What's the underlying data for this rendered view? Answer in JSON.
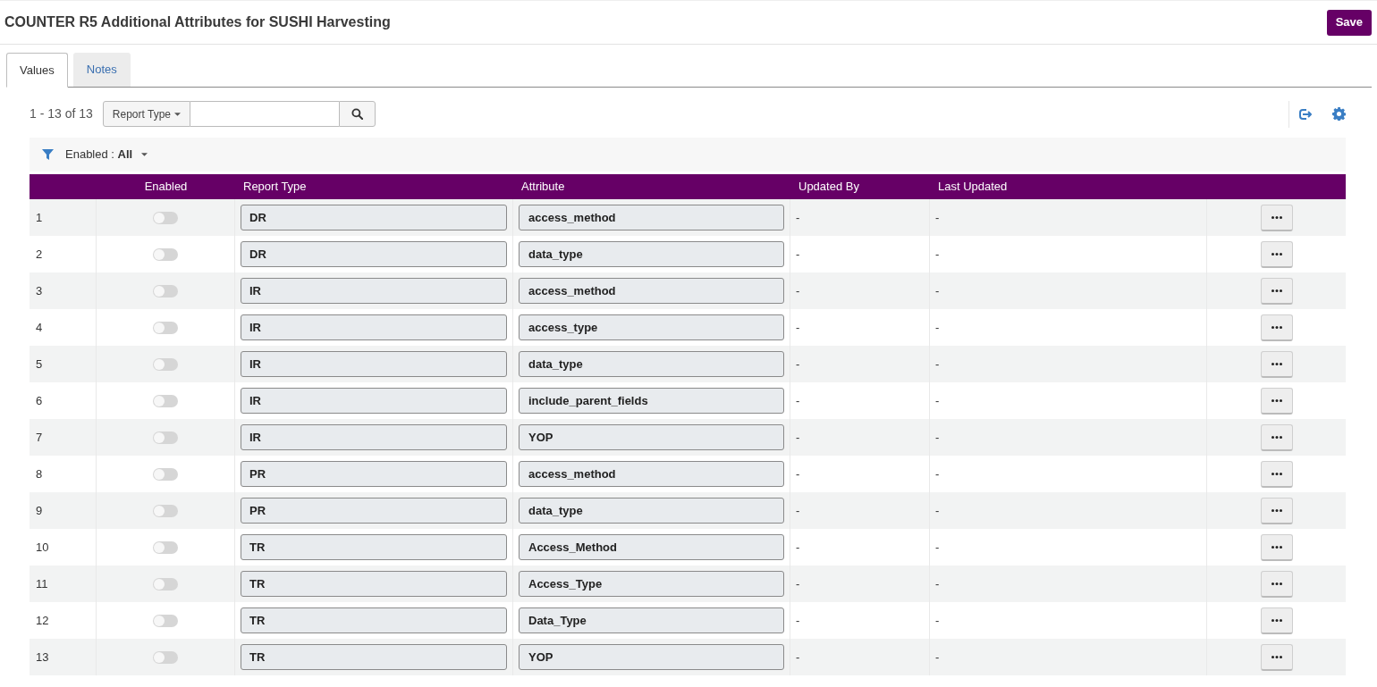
{
  "header": {
    "title": "COUNTER R5 Additional Attributes for SUSHI Harvesting",
    "save_button": "Save"
  },
  "tabs": [
    {
      "label": "Values",
      "selected": true
    },
    {
      "label": "Notes",
      "selected": false
    }
  ],
  "toolbar": {
    "count": "1 - 13 of 13",
    "search_scope": "Report Type"
  },
  "filter": {
    "label": "Enabled :",
    "value": "All"
  },
  "table": {
    "columns": [
      "Enabled",
      "Report Type",
      "Attribute",
      "Updated By",
      "Last Updated"
    ],
    "rows": [
      {
        "index": "1",
        "enabled": false,
        "report_type": "DR",
        "attribute": "access_method",
        "updated_by": "-",
        "last_updated": "-"
      },
      {
        "index": "2",
        "enabled": false,
        "report_type": "DR",
        "attribute": "data_type",
        "updated_by": "-",
        "last_updated": "-"
      },
      {
        "index": "3",
        "enabled": false,
        "report_type": "IR",
        "attribute": "access_method",
        "updated_by": "-",
        "last_updated": "-"
      },
      {
        "index": "4",
        "enabled": false,
        "report_type": "IR",
        "attribute": "access_type",
        "updated_by": "-",
        "last_updated": "-"
      },
      {
        "index": "5",
        "enabled": false,
        "report_type": "IR",
        "attribute": "data_type",
        "updated_by": "-",
        "last_updated": "-"
      },
      {
        "index": "6",
        "enabled": false,
        "report_type": "IR",
        "attribute": "include_parent_fields",
        "updated_by": "-",
        "last_updated": "-"
      },
      {
        "index": "7",
        "enabled": false,
        "report_type": "IR",
        "attribute": "YOP",
        "updated_by": "-",
        "last_updated": "-"
      },
      {
        "index": "8",
        "enabled": false,
        "report_type": "PR",
        "attribute": "access_method",
        "updated_by": "-",
        "last_updated": "-"
      },
      {
        "index": "9",
        "enabled": false,
        "report_type": "PR",
        "attribute": "data_type",
        "updated_by": "-",
        "last_updated": "-"
      },
      {
        "index": "10",
        "enabled": false,
        "report_type": "TR",
        "attribute": "Access_Method",
        "updated_by": "-",
        "last_updated": "-"
      },
      {
        "index": "11",
        "enabled": false,
        "report_type": "TR",
        "attribute": "Access_Type",
        "updated_by": "-",
        "last_updated": "-"
      },
      {
        "index": "12",
        "enabled": false,
        "report_type": "TR",
        "attribute": "Data_Type",
        "updated_by": "-",
        "last_updated": "-"
      },
      {
        "index": "13",
        "enabled": false,
        "report_type": "TR",
        "attribute": "YOP",
        "updated_by": "-",
        "last_updated": "-"
      }
    ]
  }
}
